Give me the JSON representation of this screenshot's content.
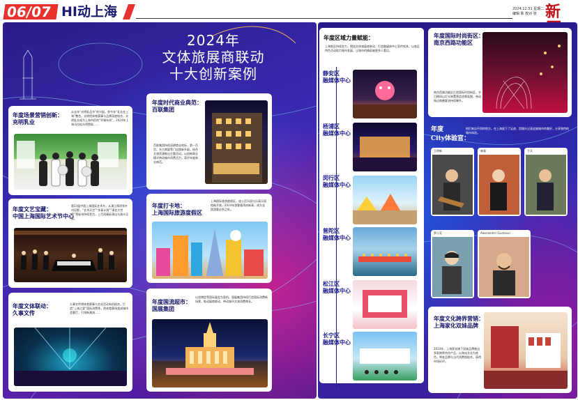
{
  "header": {
    "number": "06/07",
    "title": "HI动上海",
    "date": "2024.12.31 星期二",
    "editor": "编辑 陈 校对 张",
    "logo": "新民晚报"
  },
  "main_title": [
    "2024年",
    "文体旅展商联动",
    "十大创新案例"
  ],
  "left_cards": [
    {
      "title": "年度场景营销创新：\n充明乳业",
      "text": "从去年“光明乳品节”的兴起，到今年“乳业在上海”整合，光明把体育赛事与品牌深度结合，光明乳业成为上海市民的“早餐伙伴”，2024年上海马拉松光明赞助……"
    },
    {
      "title": "年度文艺宝藏：\n中国上海国际艺术节中心",
      "text": "第23届中国上海国际艺术节，从浦江两岸到乡村田野，“艺术天空”“扶青计划”“演艺大世界”等板块持续发力，上百项精彩演出与观众见面。"
    },
    {
      "title": "年度文体联动：\n久事文传",
      "text": "久事文传将体育赛事与文化活动有机结合，打造“上海之夏”国际消费季，把体育赛场变成城市会客厅，引领新潮流……"
    }
  ],
  "mid_cards": [
    {
      "title": "年度时代商业典范：\n百联集团",
      "text": "百联集团持续深耕商业地标，第一百货、东方商厦等门店焕新升级，结合文旅资源推出主题活动，以创新商业模式带动城市消费活力，获评年度商业典范。"
    },
    {
      "title": "年度打卡地：\n上海国际旅游度假区",
      "text": "上海国际旅游度假区，迪士尼乐园与乐高乐园相继开放，2024年游客量再创新高，成为全国游客必到之处。"
    },
    {
      "title": "年度国流超市：\n国展集团",
      "text": "以进博会等国际展会为契机，国展集团持续打造国际消费新场景，推动展商联动，带动城市文旅消费增长。"
    }
  ],
  "districts_block": {
    "title": "年度区域力量赋能：",
    "text": "上海各区持续发力，围绕文体旅展商联动，打造融媒体中心宣传矩阵，以各区特色活动助力城市发展，让城市的精彩被更多人看见。",
    "districts": [
      "静安区\n融媒体中心",
      "杨浦区\n融媒体中心",
      "闵行区\n融媒体中心",
      "普陀区\n融媒体中心",
      "松江区\n融媒体中心",
      "长宁区\n融媒体中心"
    ]
  },
  "right_cards": [
    {
      "title": "年度国际时尚街区：\n南京西路功能区",
      "text": "南京西路功能区打造国际时尚街区，节日期间以灯光装置营造浓厚氛围，带动周边商圈客流持续攀升。"
    },
    {
      "title": "年度文化跨界营销：\n上海家化双妹品牌",
      "text": "2024年，上海家化旗下双妹品牌推出多款跨界合作产品，以海派文化为底色，将老品牌与当代消费相结合，获得市场好评。"
    }
  ],
  "city_section": {
    "title": "年度\nCity体验官：",
    "text": "他们来自不同的地方，在上海留下了足迹，用镜头记录这座城市的美好，分享独特的城市体验。",
    "people": [
      "王明新",
      "林青",
      "于天",
      "罗小芳",
      "Alessandro (Gustavo)"
    ]
  },
  "colors": {
    "accent": "#e8322e",
    "navy": "#16166a",
    "purple": "#3b2bb5"
  }
}
